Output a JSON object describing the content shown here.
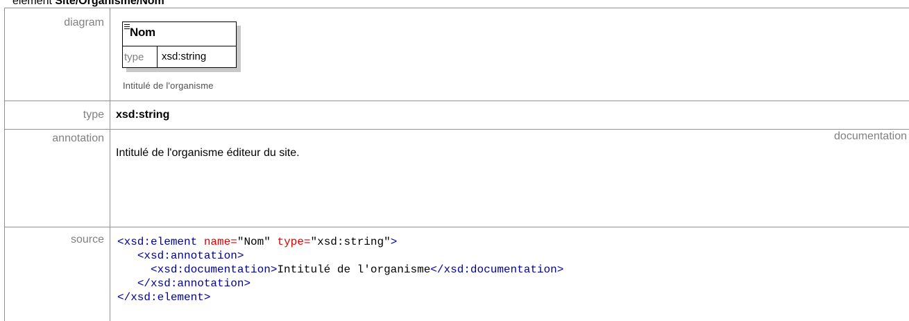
{
  "heading": {
    "prefix": "element ",
    "path": "Site/Organisme/Nom"
  },
  "rows": {
    "diagram_label": "diagram",
    "type_label": "type",
    "annotation_label": "annotation",
    "source_label": "source"
  },
  "diagram": {
    "element_name": "Nom",
    "type_label": "type",
    "type_value": "xsd:string",
    "caption": "Intitulé de l'organisme"
  },
  "type": {
    "value": "xsd:string"
  },
  "annotation": {
    "tag": "documentation",
    "text": "Intitulé de l'organisme éditeur du site."
  },
  "source": {
    "line1_open": "<xsd:element",
    "line1_attr1": "name=",
    "line1_val1": "\"Nom\"",
    "line1_attr2": "type=",
    "line1_val2": "\"xsd:string\"",
    "line1_close": ">",
    "line2": "<xsd:annotation>",
    "line3_open": "<xsd:documentation>",
    "line3_text": "Intitulé de l'organisme",
    "line3_close": "</xsd:documentation>",
    "line4": "</xsd:annotation>",
    "line5": "</xsd:element>"
  }
}
